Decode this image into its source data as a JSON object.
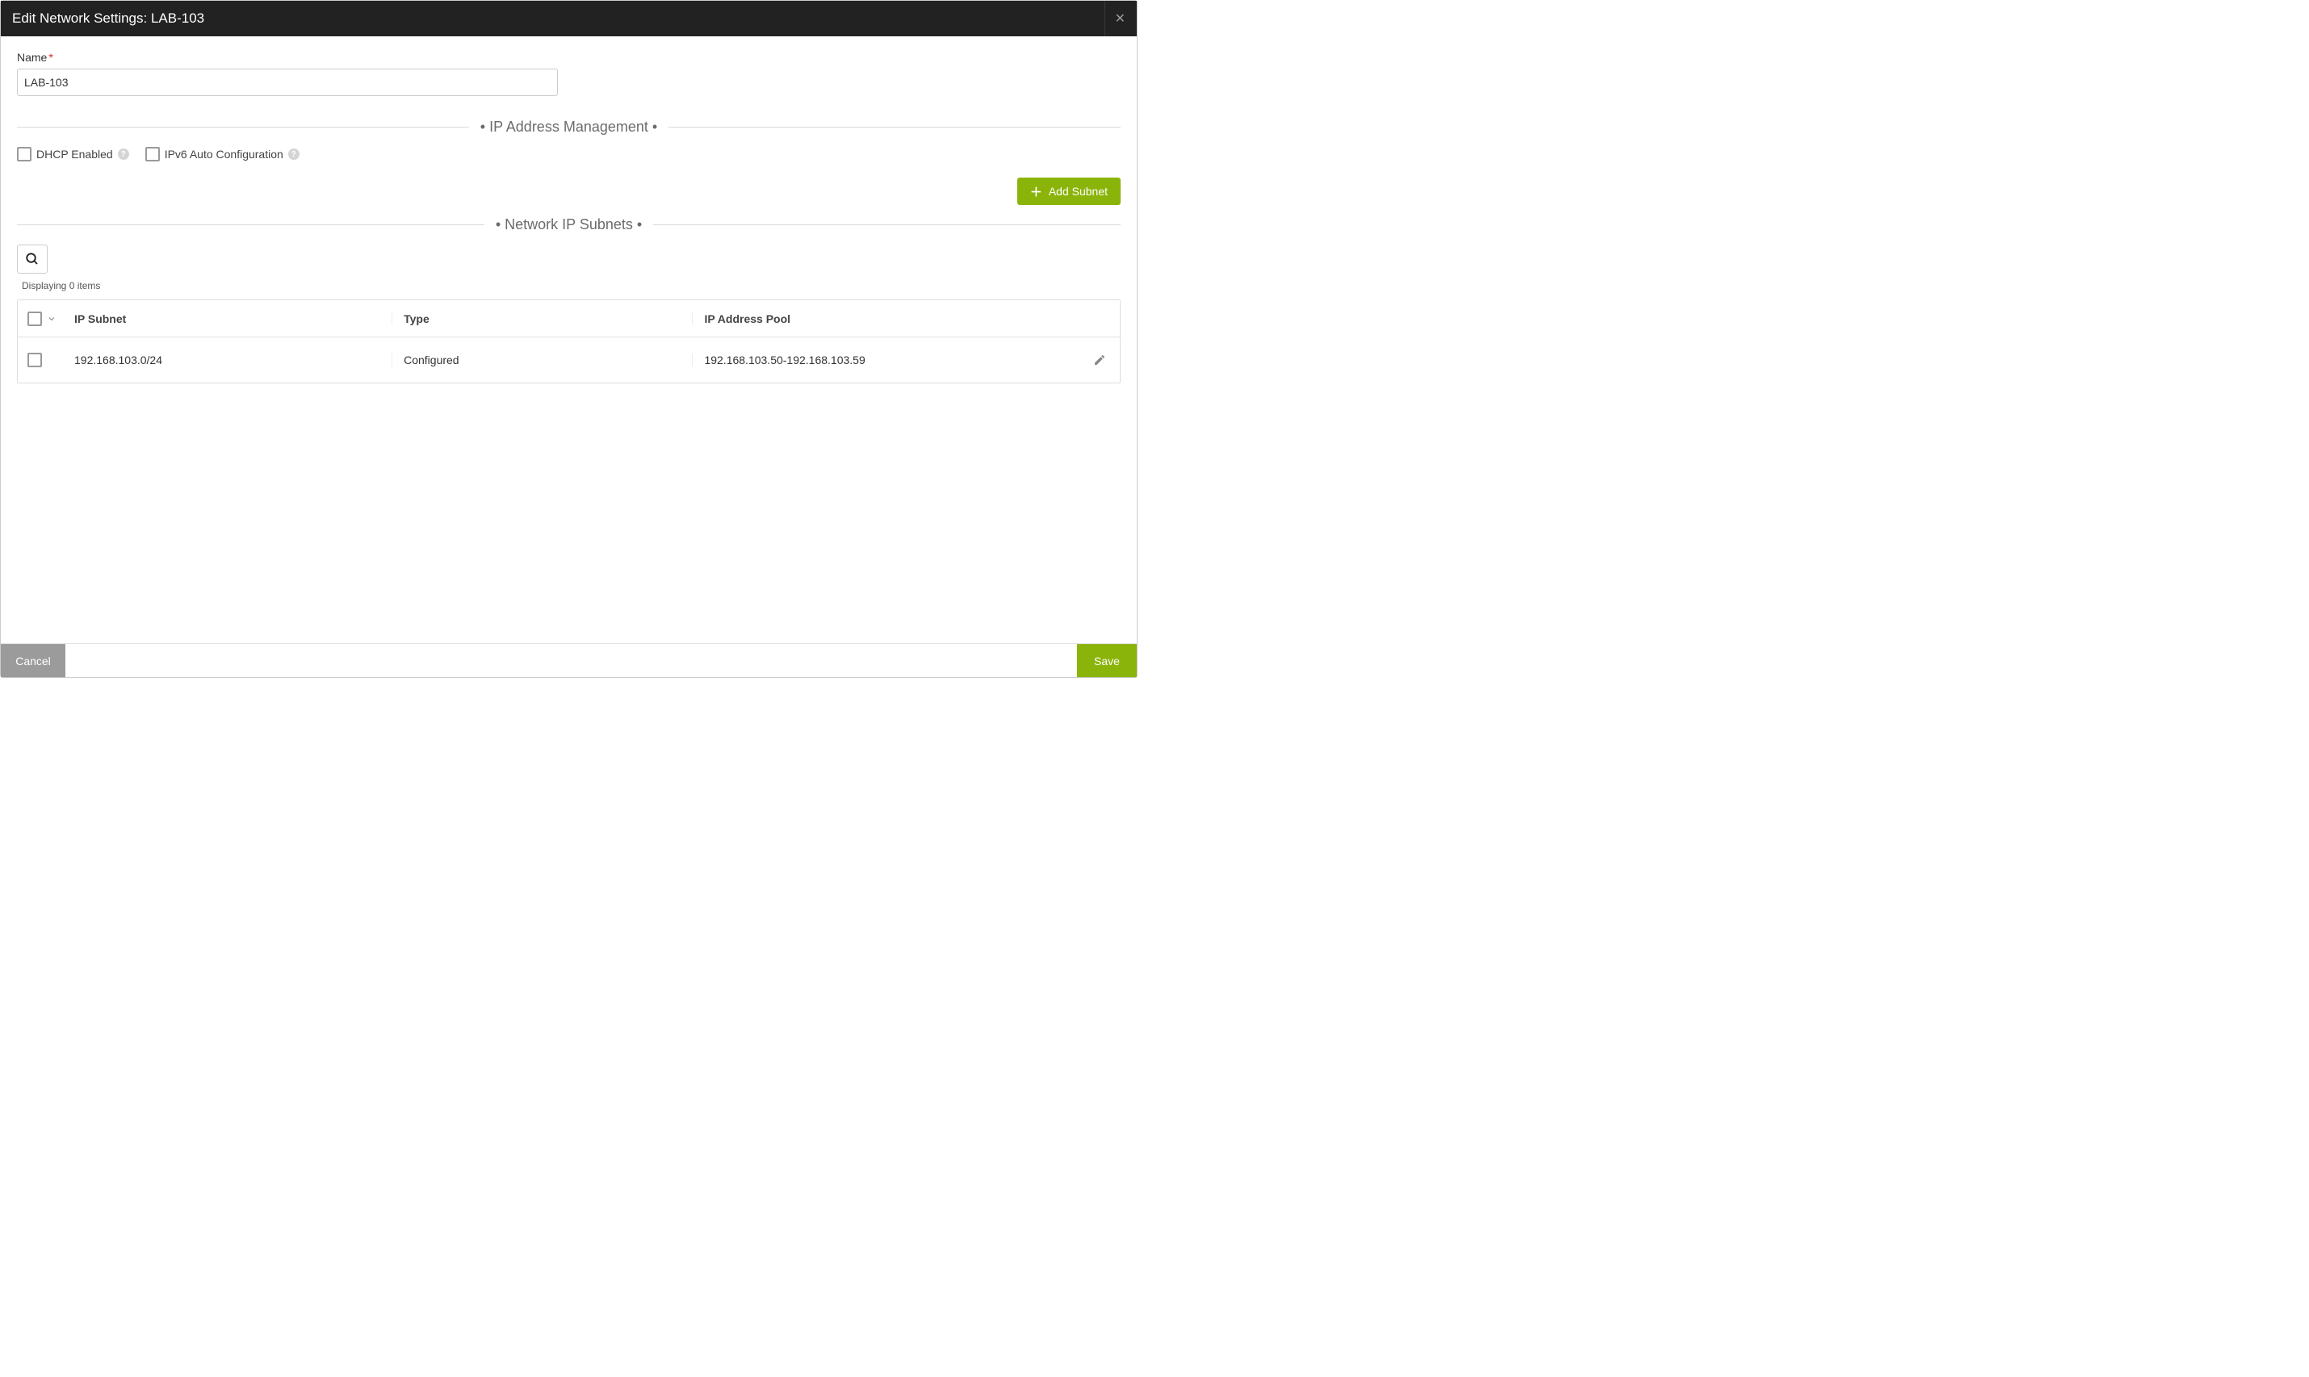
{
  "header": {
    "title": "Edit Network Settings: LAB-103"
  },
  "fields": {
    "name_label": "Name",
    "name_value": "LAB-103"
  },
  "sections": {
    "ipam": "• IP Address Management •",
    "subnets": "• Network IP Subnets •"
  },
  "checkboxes": {
    "dhcp_label": "DHCP Enabled",
    "ipv6_label": "IPv6 Auto Configuration"
  },
  "buttons": {
    "add_subnet": "Add Subnet",
    "cancel": "Cancel",
    "save": "Save"
  },
  "table": {
    "display_text": "Displaying 0 items",
    "headers": {
      "subnet": "IP Subnet",
      "type": "Type",
      "pool": "IP Address Pool"
    },
    "rows": [
      {
        "subnet": "192.168.103.0/24",
        "type": "Configured",
        "pool": "192.168.103.50-192.168.103.59"
      }
    ]
  }
}
